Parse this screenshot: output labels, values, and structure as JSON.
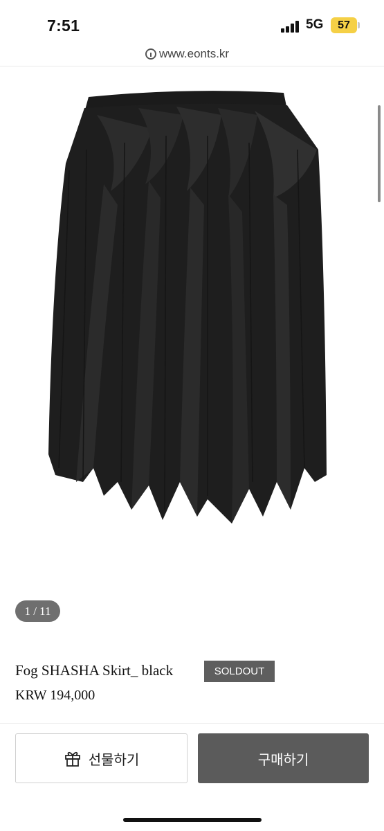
{
  "status_bar": {
    "time": "7:51",
    "network": "5G",
    "battery": "57"
  },
  "browser": {
    "url": "www.eonts.kr"
  },
  "gallery": {
    "pager": "1 / 11",
    "image_alt": "black pleated skirt"
  },
  "product": {
    "name": "Fog SHASHA Skirt_ black",
    "badge": "SOLDOUT",
    "price": "KRW 194,000"
  },
  "actions": {
    "gift_label": "선물하기",
    "buy_label": "구매하기"
  },
  "icons": {
    "gift": "gift-icon",
    "info": "info-icon"
  }
}
